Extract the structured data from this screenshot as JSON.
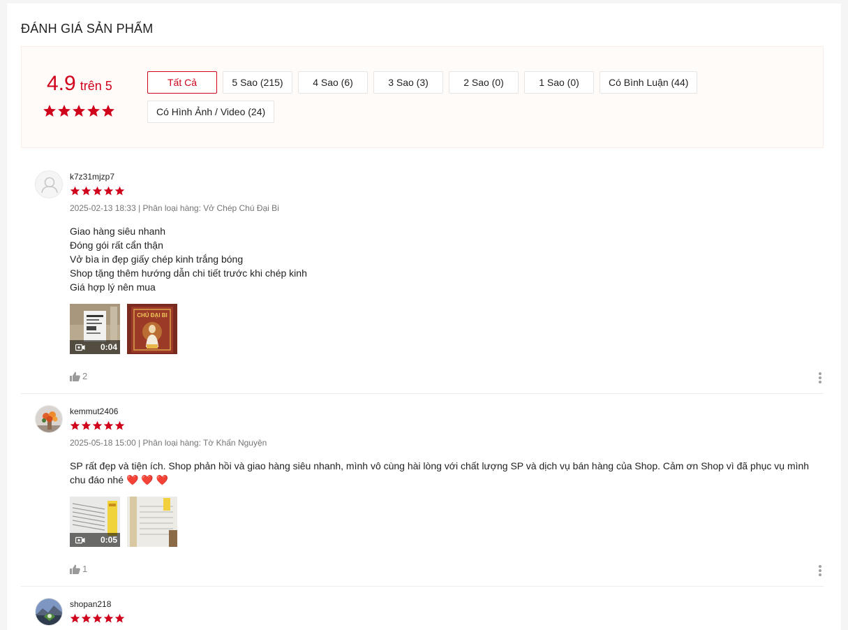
{
  "section_title": "ĐÁNH GIÁ SẢN PHẨM",
  "overview": {
    "rating": "4.9",
    "out_of": "trên 5",
    "rating_value": 4.9,
    "stars": 5
  },
  "filters": [
    {
      "label": "Tất Cả",
      "active": true
    },
    {
      "label": "5 Sao (215)",
      "active": false
    },
    {
      "label": "4 Sao (6)",
      "active": false
    },
    {
      "label": "3 Sao (3)",
      "active": false
    },
    {
      "label": "2 Sao (0)",
      "active": false
    },
    {
      "label": "1 Sao (0)",
      "active": false
    },
    {
      "label": "Có Bình Luận (44)",
      "active": false
    },
    {
      "label": "Có Hình Ảnh / Video (24)",
      "active": false
    }
  ],
  "reviews": [
    {
      "username": "k7z31mjzp7",
      "stars": 5,
      "meta": "2025-02-13 18:33 | Phân loại hàng: Vở Chép Chú Đại Bi",
      "body_lines": [
        "Giao hàng siêu nhanh",
        "Đóng gói rất cẩn thận",
        "Vở bìa in đẹp giấy chép kinh trắng bóng",
        "Shop tặng thêm hướng dẫn chi tiết trước khi chép kinh",
        "Giá hợp lý nên mua"
      ],
      "media": [
        {
          "kind": "video",
          "duration": "0:04"
        },
        {
          "kind": "image",
          "caption": "CHÚ ĐẠI BI"
        }
      ],
      "likes": "2",
      "avatar": "default-avatar"
    },
    {
      "username": "kemmut2406",
      "stars": 5,
      "meta": "2025-05-18 15:00 | Phân loại hàng: Tờ Khấn Nguyện",
      "body_lines": [
        "SP rất đẹp và tiện ích. Shop phản hồi và giao hàng siêu nhanh, mình vô cùng hài lòng với chất lượng SP và dịch vụ bán hàng của Shop. Cảm ơn Shop vì đã phục vụ mình",
        "chu đáo nhé ❤️ ❤️ ❤️"
      ],
      "media": [
        {
          "kind": "video",
          "duration": "0:05"
        },
        {
          "kind": "image"
        }
      ],
      "likes": "1",
      "avatar": "flower-avatar"
    },
    {
      "username": "shopan218",
      "stars": 5,
      "avatar": "landscape-avatar"
    }
  ],
  "colors": {
    "accent": "#d0011b",
    "overview_bg": "#fffbf8",
    "muted": "#757575"
  }
}
